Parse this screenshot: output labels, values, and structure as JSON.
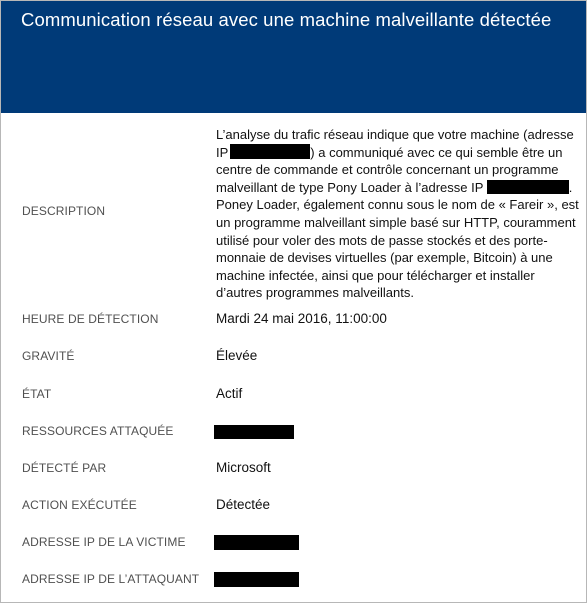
{
  "header": {
    "title": "Communication réseau avec une machine malveillante détectée"
  },
  "description": {
    "label": "DESCRIPTION",
    "text_part1": "L’analyse du trafic réseau indique que votre machine (adresse IP",
    "text_part2": ") a communiqué avec ce qui semble être un centre de commande et contrôle concernant un programme malveillant de type Pony Loader à l’adresse IP",
    "text_part3": ". Poney Loader, également connu sous le nom de « Fareir », est un programme malveillant simple basé sur HTTP, couramment utilisé pour voler des mots de passe stockés et des porte-monnaie de devises virtuelles (par exemple, Bitcoin) à une machine infectée, ainsi que pour télécharger et installer d’autres programmes malveillants."
  },
  "fields": {
    "detection_time": {
      "label": "HEURE DE DÉTECTION",
      "value": "Mardi 24 mai 2016, 11:00:00"
    },
    "severity": {
      "label": "GRAVITÉ",
      "value": "Élevée"
    },
    "state": {
      "label": "ÉTAT",
      "value": "Actif"
    },
    "attacked_resources": {
      "label": "RESSOURCES ATTAQUÉE"
    },
    "detected_by": {
      "label": "DÉTECTÉ PAR",
      "value": "Microsoft"
    },
    "action_taken": {
      "label": "ACTION EXÉCUTÉE",
      "value": "Détectée"
    },
    "victim_ip": {
      "label": "ADRESSE IP DE LA VICTIME"
    },
    "attacker_ip": {
      "label": "ADRESSE IP DE L’ATTAQUANT"
    }
  },
  "colors": {
    "header_bg": "#003a78",
    "header_text": "#ffffff",
    "redaction": "#000000"
  }
}
